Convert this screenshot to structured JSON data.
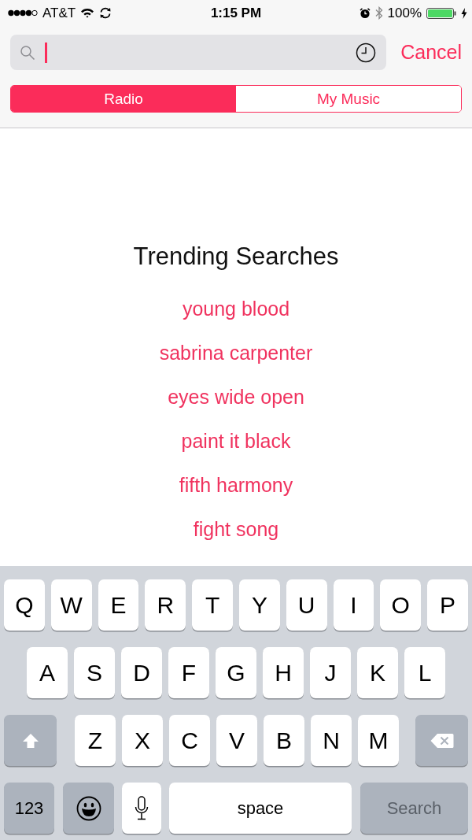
{
  "status_bar": {
    "carrier": "AT&T",
    "time": "1:15 PM",
    "battery": "100%"
  },
  "search": {
    "cancel": "Cancel"
  },
  "segments": [
    {
      "label": "Radio",
      "selected": true
    },
    {
      "label": "My Music",
      "selected": false
    }
  ],
  "trending": {
    "title": "Trending Searches",
    "items": [
      "young blood",
      "sabrina carpenter",
      "eyes wide open",
      "paint it black",
      "fifth harmony",
      "fight song"
    ]
  },
  "keyboard": {
    "rows": [
      {
        "keys": [
          {
            "kind": "letter",
            "label": "Q"
          },
          {
            "kind": "letter",
            "label": "W"
          },
          {
            "kind": "letter",
            "label": "E"
          },
          {
            "kind": "letter",
            "label": "R"
          },
          {
            "kind": "letter",
            "label": "T"
          },
          {
            "kind": "letter",
            "label": "Y"
          },
          {
            "kind": "letter",
            "label": "U"
          },
          {
            "kind": "letter",
            "label": "I"
          },
          {
            "kind": "letter",
            "label": "O"
          },
          {
            "kind": "letter",
            "label": "P"
          }
        ]
      },
      {
        "keys": [
          {
            "kind": "letter",
            "label": "A"
          },
          {
            "kind": "letter",
            "label": "S"
          },
          {
            "kind": "letter",
            "label": "D"
          },
          {
            "kind": "letter",
            "label": "F"
          },
          {
            "kind": "letter",
            "label": "G"
          },
          {
            "kind": "letter",
            "label": "H"
          },
          {
            "kind": "letter",
            "label": "J"
          },
          {
            "kind": "letter",
            "label": "K"
          },
          {
            "kind": "letter",
            "label": "L"
          }
        ]
      },
      {
        "keys": [
          {
            "kind": "shift"
          },
          {
            "kind": "letter",
            "label": "Z"
          },
          {
            "kind": "letter",
            "label": "X"
          },
          {
            "kind": "letter",
            "label": "C"
          },
          {
            "kind": "letter",
            "label": "V"
          },
          {
            "kind": "letter",
            "label": "B"
          },
          {
            "kind": "letter",
            "label": "N"
          },
          {
            "kind": "letter",
            "label": "M"
          },
          {
            "kind": "delete"
          }
        ]
      },
      {
        "keys": [
          {
            "kind": "numbers",
            "label": "123"
          },
          {
            "kind": "emoji"
          },
          {
            "kind": "mic"
          },
          {
            "kind": "space",
            "label": "space"
          },
          {
            "kind": "search",
            "label": "Search",
            "disabled": true
          }
        ]
      }
    ]
  }
}
